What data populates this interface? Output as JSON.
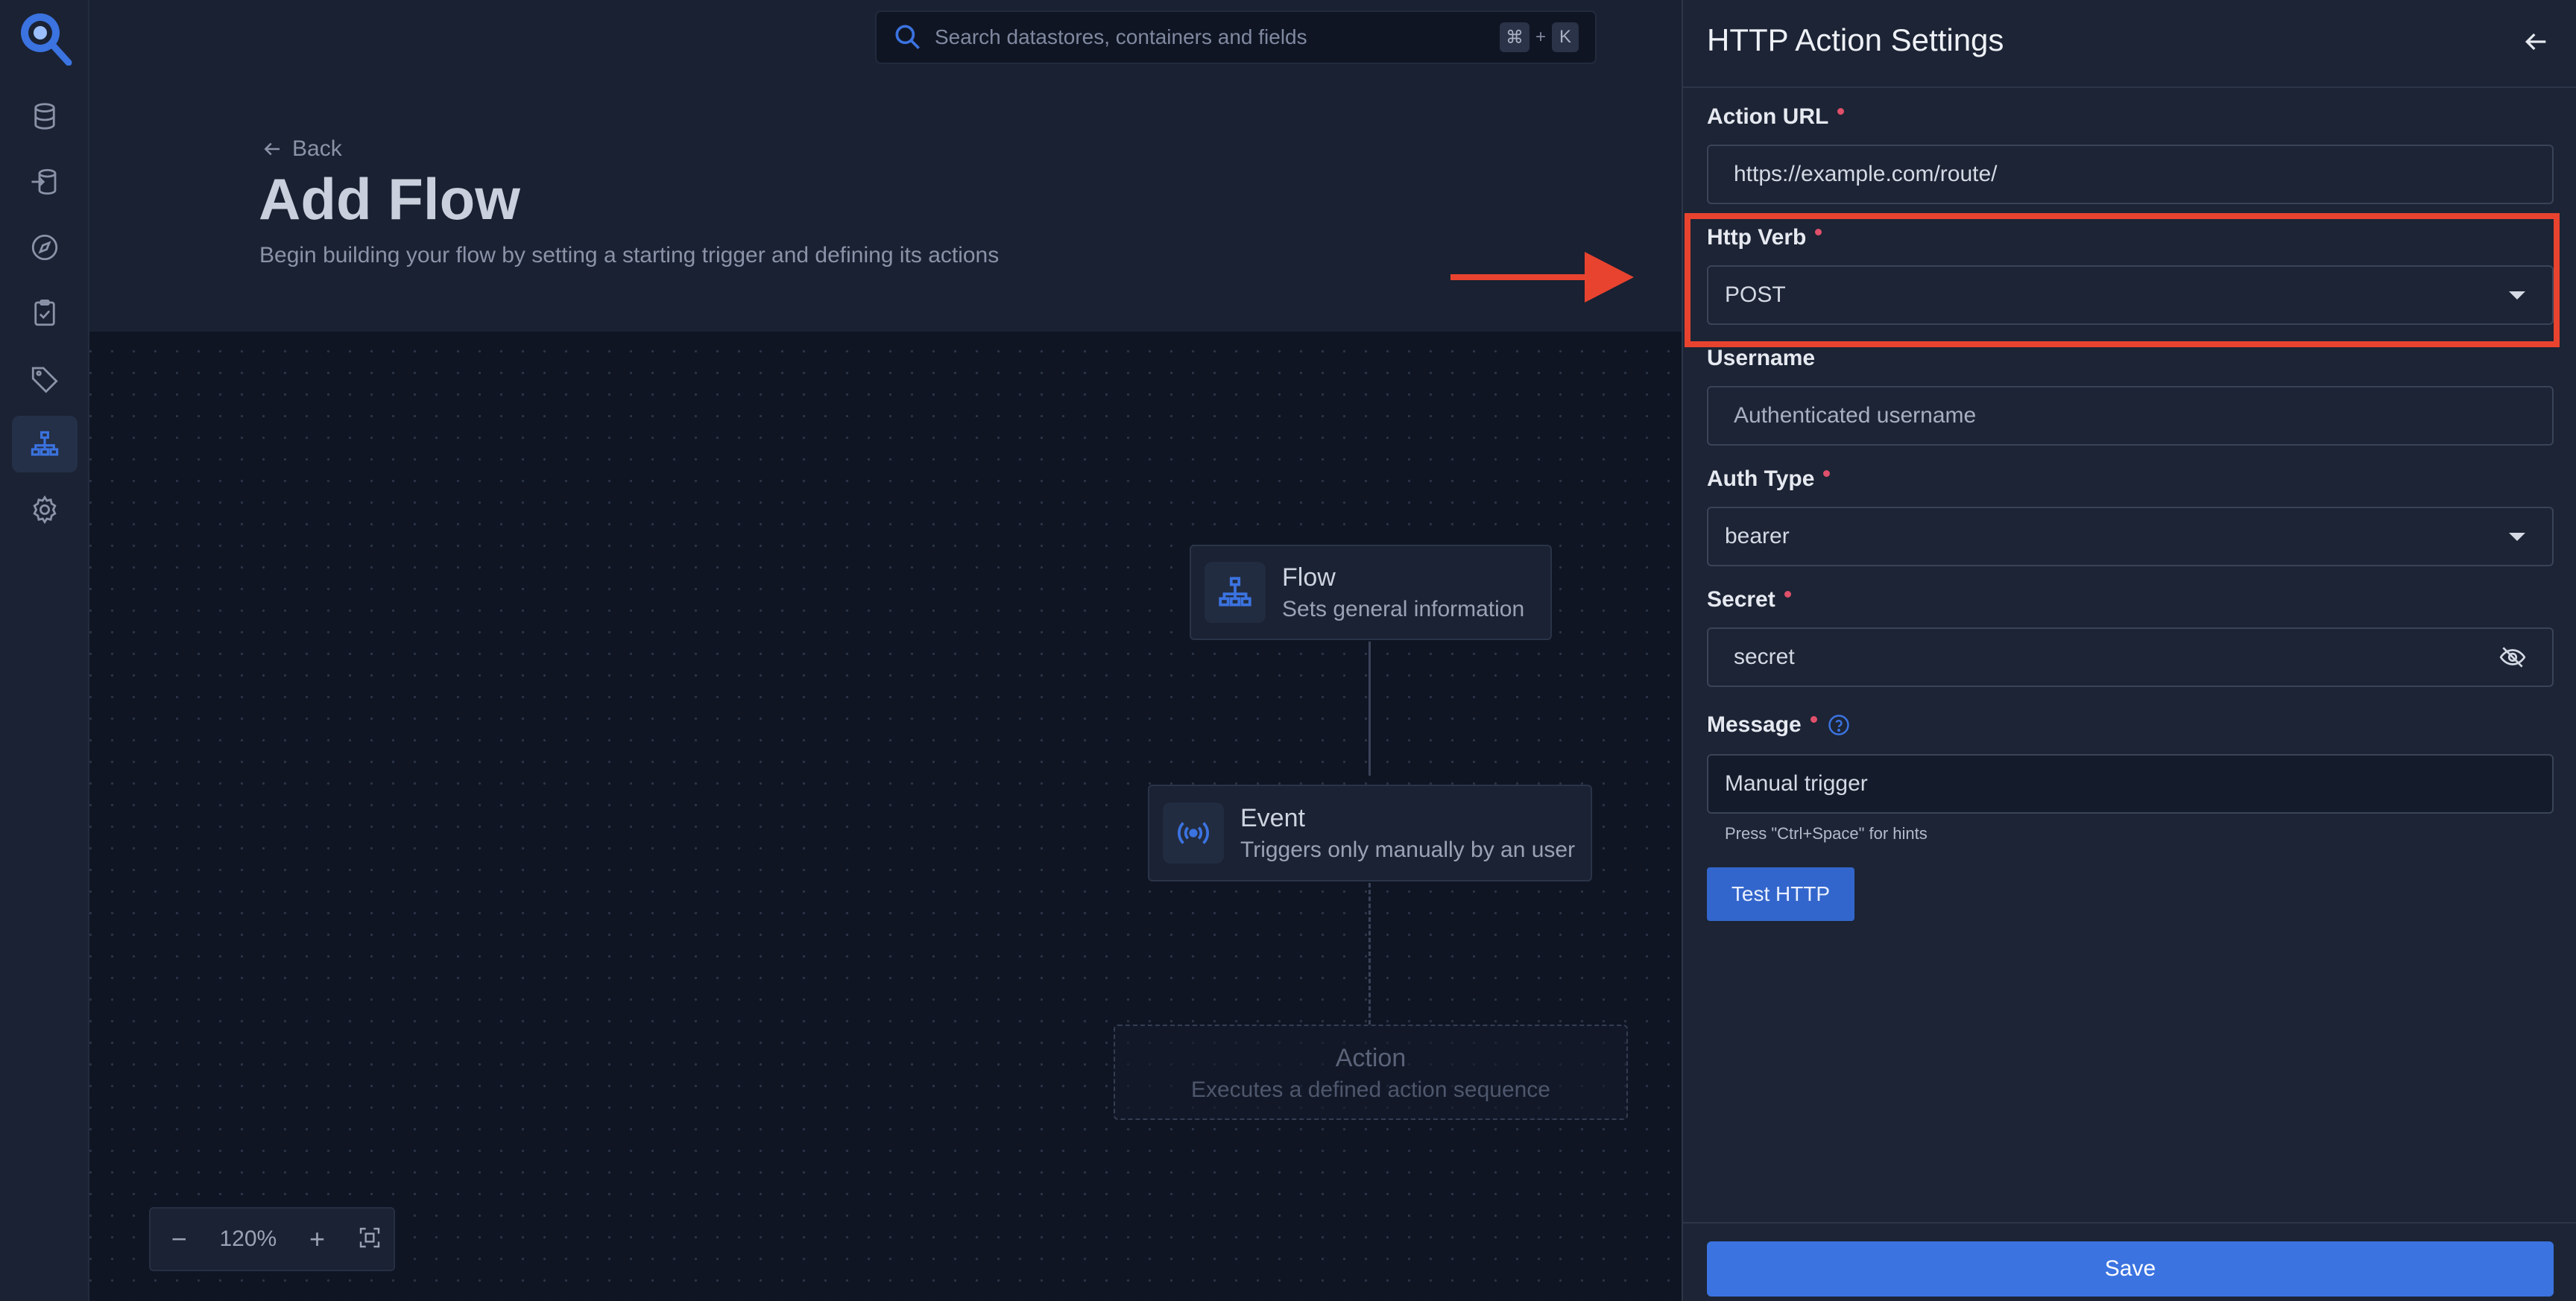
{
  "search": {
    "placeholder": "Search datastores, containers and fields",
    "shortcut_key1": "⌘",
    "shortcut_plus": "+",
    "shortcut_key2": "K"
  },
  "header": {
    "back_label": "Back",
    "title": "Add Flow",
    "subtitle": "Begin building your flow by setting a starting trigger and defining its actions"
  },
  "sidebar": {
    "items": [
      {
        "icon": "database-icon"
      },
      {
        "icon": "datastore-arrow-icon"
      },
      {
        "icon": "compass-icon"
      },
      {
        "icon": "clipboard-check-icon"
      },
      {
        "icon": "tag-icon"
      },
      {
        "icon": "flows-icon",
        "active": true
      },
      {
        "icon": "gear-icon"
      }
    ]
  },
  "flow": {
    "nodes": {
      "flow": {
        "title": "Flow",
        "desc": "Sets general information"
      },
      "event": {
        "title": "Event",
        "desc": "Triggers only manually by an user"
      },
      "action": {
        "title": "Action",
        "desc": "Executes a defined action sequence"
      }
    },
    "zoom": {
      "minus": "−",
      "level": "120%",
      "plus": "+"
    }
  },
  "panel": {
    "title": "HTTP Action Settings",
    "fields": {
      "action_url": {
        "label": "Action URL",
        "value": "https://example.com/route/"
      },
      "http_verb": {
        "label": "Http Verb",
        "value": "POST"
      },
      "username": {
        "label": "Username",
        "placeholder": "Authenticated username"
      },
      "auth_type": {
        "label": "Auth Type",
        "value": "bearer"
      },
      "secret": {
        "label": "Secret",
        "value": "secret"
      },
      "message": {
        "label": "Message",
        "value": "Manual trigger",
        "hint": "Press \"Ctrl+Space\" for hints"
      }
    },
    "test_button": "Test HTTP",
    "save_button": "Save"
  },
  "colors": {
    "accent": "#3b73e0",
    "annotation": "#e8432f",
    "required": "#e0506a"
  }
}
